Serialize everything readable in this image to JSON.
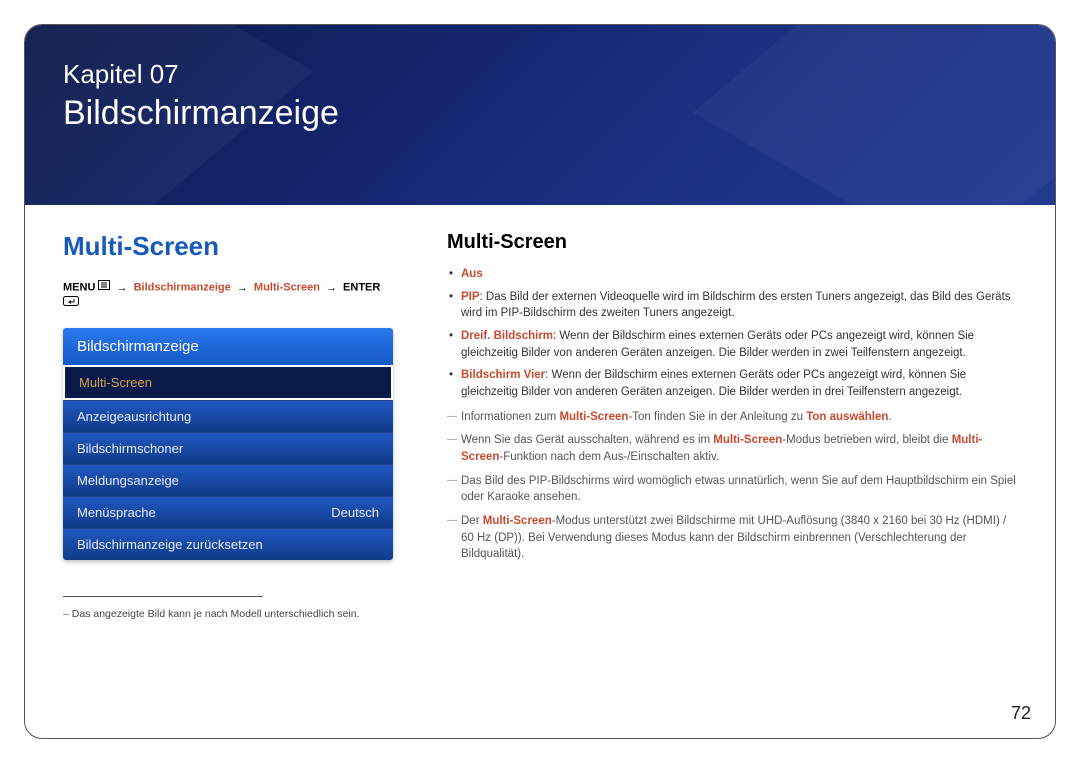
{
  "header": {
    "chapter_line": "Kapitel 07",
    "chapter_title": "Bildschirmanzeige"
  },
  "left": {
    "heading": "Multi-Screen",
    "menu_path": {
      "prefix": "MENU",
      "parts": [
        "Bildschirmanzeige",
        "Multi-Screen"
      ],
      "enter": "ENTER"
    },
    "osd": {
      "header": "Bildschirmanzeige",
      "items": [
        {
          "label": "Multi-Screen",
          "value": "",
          "selected": true
        },
        {
          "label": "Anzeigeausrichtung",
          "value": ""
        },
        {
          "label": "Bildschirmschoner",
          "value": ""
        },
        {
          "label": "Meldungsanzeige",
          "value": ""
        },
        {
          "label": "Menüsprache",
          "value": "Deutsch"
        },
        {
          "label": "Bildschirmanzeige zurücksetzen",
          "value": ""
        }
      ]
    },
    "footnote": "Das angezeigte Bild kann je nach Modell unterschiedlich sein."
  },
  "right": {
    "heading": "Multi-Screen",
    "bullets": [
      {
        "term": "Aus",
        "text": ""
      },
      {
        "term": "PIP",
        "text": ": Das Bild der externen Videoquelle wird im Bildschirm des ersten Tuners angezeigt, das Bild des Geräts wird im PIP-Bildschirm des zweiten Tuners angezeigt."
      },
      {
        "term": "Dreif. Bildschirm",
        "text": ": Wenn der Bildschirm eines externen Geräts oder PCs angezeigt wird, können Sie gleichzeitig Bilder von anderen Geräten anzeigen. Die Bilder werden in zwei Teilfenstern angezeigt."
      },
      {
        "term": "Bildschirm Vier",
        "text": ": Wenn der Bildschirm eines externen Geräts oder PCs angezeigt wird, können Sie gleichzeitig Bilder von anderen Geräten anzeigen. Die Bilder werden in drei Teilfenstern angezeigt."
      }
    ],
    "notes": [
      {
        "pre": "Informationen zum ",
        "hl1": "Multi-Screen",
        "mid": "-Ton finden Sie in der Anleitung zu ",
        "hl2": "Ton auswählen",
        "post": "."
      },
      {
        "pre": "Wenn Sie das Gerät ausschalten, während es im ",
        "hl1": "Multi-Screen",
        "mid": "-Modus betrieben wird, bleibt die ",
        "hl2": "Multi-Screen",
        "post": "-Funktion nach dem Aus-/Einschalten aktiv."
      },
      {
        "pre": "Das Bild des PIP-Bildschirms wird womöglich etwas unnatürlich, wenn Sie auf dem Hauptbildschirm ein Spiel oder Karaoke ansehen.",
        "hl1": "",
        "mid": "",
        "hl2": "",
        "post": ""
      },
      {
        "pre": "Der ",
        "hl1": "Multi-Screen",
        "mid": "-Modus unterstützt zwei Bildschirme mit UHD-Auflösung (3840 x 2160 bei 30 Hz (HDMI) / 60 Hz (DP)). Bei Verwendung dieses Modus kann der Bildschirm einbrennen (Verschlechterung der Bildqualität).",
        "hl2": "",
        "post": ""
      }
    ]
  },
  "page_number": "72"
}
